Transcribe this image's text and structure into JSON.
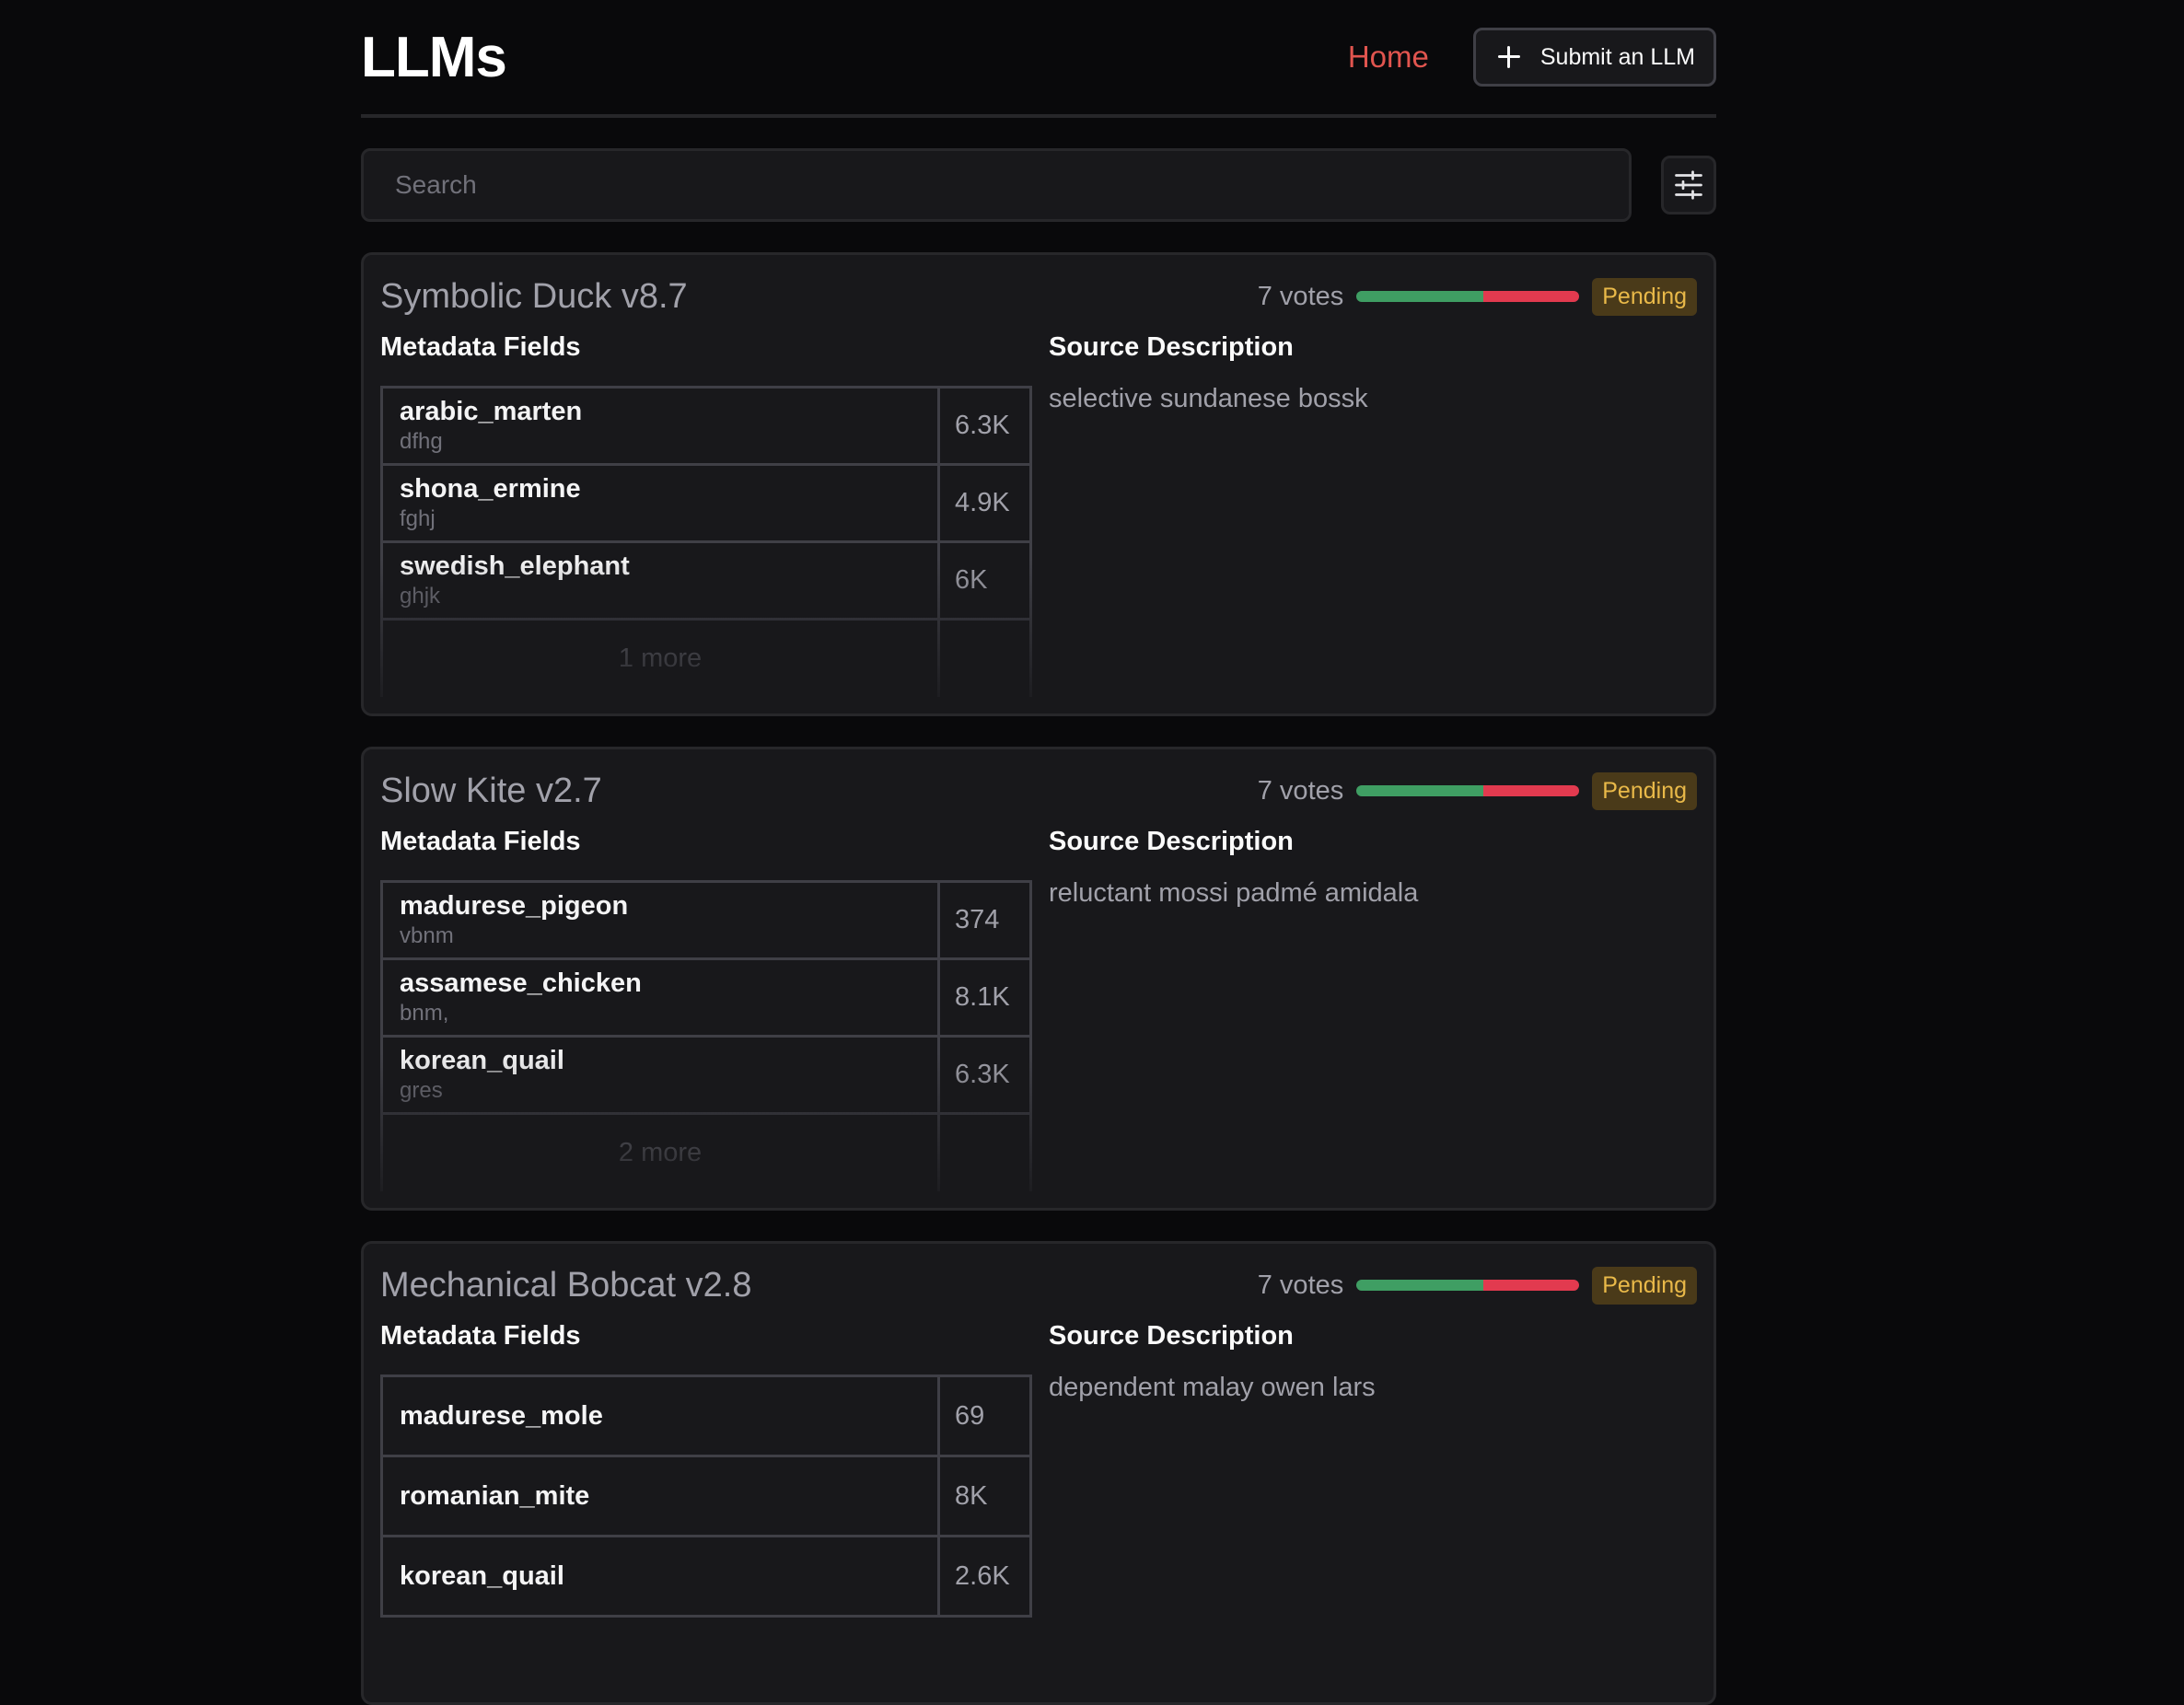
{
  "header": {
    "logo": "LLMs",
    "nav_home": "Home",
    "submit_label": "Submit an LLM"
  },
  "search": {
    "placeholder": "Search",
    "filter_icon": "sliders-icon"
  },
  "colors": {
    "accent": "#e1554f",
    "vote_up": "#3f9e63",
    "vote_down": "#e23a4f",
    "pending": "#e9b949"
  },
  "cards": [
    {
      "title": "Symbolic Duck v8.7",
      "votes": "7 votes",
      "vote_up_fraction": 0.57,
      "status": "Pending",
      "metadata_label": "Metadata Fields",
      "source_label": "Source Description",
      "source_text": "selective sundanese bossk",
      "fields": [
        {
          "name": "arabic_marten",
          "sub": "dfhg",
          "value": "6.3K"
        },
        {
          "name": "shona_ermine",
          "sub": "fghj",
          "value": "4.9K"
        },
        {
          "name": "swedish_elephant",
          "sub": "ghjk",
          "value": "6K"
        }
      ],
      "more": "1 more"
    },
    {
      "title": "Slow Kite v2.7",
      "votes": "7 votes",
      "vote_up_fraction": 0.57,
      "status": "Pending",
      "metadata_label": "Metadata Fields",
      "source_label": "Source Description",
      "source_text": "reluctant mossi padmé amidala",
      "fields": [
        {
          "name": "madurese_pigeon",
          "sub": "vbnm",
          "value": "374"
        },
        {
          "name": "assamese_chicken",
          "sub": "bnm,",
          "value": "8.1K"
        },
        {
          "name": "korean_quail",
          "sub": "gres",
          "value": "6.3K"
        }
      ],
      "more": "2 more"
    },
    {
      "title": "Mechanical Bobcat v2.8",
      "votes": "7 votes",
      "vote_up_fraction": 0.57,
      "status": "Pending",
      "metadata_label": "Metadata Fields",
      "source_label": "Source Description",
      "source_text": "dependent malay owen lars",
      "fields": [
        {
          "name": "madurese_mole",
          "sub": "",
          "value": "69"
        },
        {
          "name": "romanian_mite",
          "sub": "",
          "value": "8K"
        },
        {
          "name": "korean_quail",
          "sub": "",
          "value": "2.6K"
        }
      ],
      "more": ""
    }
  ]
}
